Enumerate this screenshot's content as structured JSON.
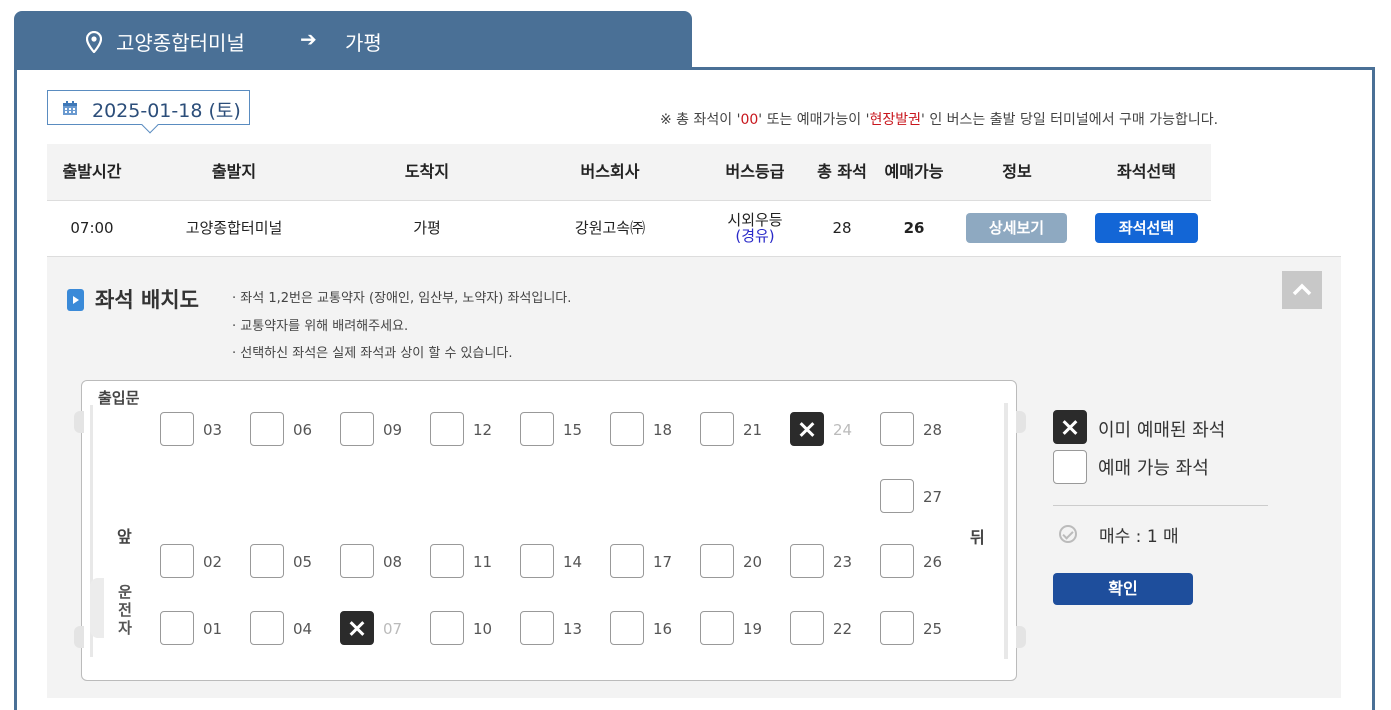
{
  "route": {
    "departure": "고양종합터미널",
    "arrow": "➔",
    "arrival": "가평"
  },
  "date": "2025-01-18 (토)",
  "notice": {
    "prefix": "※ 총 좌석이 '",
    "highlight1": "00",
    "middle": "' 또는 예매가능이 '",
    "highlight2": "현장발권",
    "suffix": "' 인 버스는 출발 당일 터미널에서 구매 가능합니다."
  },
  "table": {
    "headers": [
      "출발시간",
      "출발지",
      "도착지",
      "버스회사",
      "버스등급",
      "총 좌석",
      "예매가능",
      "정보",
      "좌석선택"
    ],
    "row": {
      "time": "07:00",
      "departure": "고양종합터미널",
      "arrival": "가평",
      "company": "강원고속㈜",
      "grade": "시외우등",
      "grade_sub": "(경유)",
      "total_seats": "28",
      "available": "26",
      "detail_button": "상세보기",
      "select_button": "좌석선택"
    }
  },
  "seat_panel": {
    "title": "좌석 배치도",
    "notes": [
      "· 좌석 1,2번은 교통약자 (장애인, 임산부, 노약자) 좌석입니다.",
      "· 교통약자를 위해 배려해주세요.",
      "· 선택하신 좌석은 실제 좌석과 상이 할 수 있습니다."
    ],
    "door_label": "출입문",
    "front_label": "앞",
    "back_label": "뒤",
    "driver_label": "운전자",
    "seat_rows": [
      [
        {
          "num": "03",
          "booked": false
        },
        {
          "num": "06",
          "booked": false
        },
        {
          "num": "09",
          "booked": false
        },
        {
          "num": "12",
          "booked": false
        },
        {
          "num": "15",
          "booked": false
        },
        {
          "num": "18",
          "booked": false
        },
        {
          "num": "21",
          "booked": false
        },
        {
          "num": "24",
          "booked": true
        },
        {
          "num": "28",
          "booked": false
        }
      ],
      [
        {
          "num": "27",
          "booked": false
        }
      ],
      [
        {
          "num": "02",
          "booked": false
        },
        {
          "num": "05",
          "booked": false
        },
        {
          "num": "08",
          "booked": false
        },
        {
          "num": "11",
          "booked": false
        },
        {
          "num": "14",
          "booked": false
        },
        {
          "num": "17",
          "booked": false
        },
        {
          "num": "20",
          "booked": false
        },
        {
          "num": "23",
          "booked": false
        },
        {
          "num": "26",
          "booked": false
        }
      ],
      [
        {
          "num": "01",
          "booked": false
        },
        {
          "num": "04",
          "booked": false
        },
        {
          "num": "07",
          "booked": true
        },
        {
          "num": "10",
          "booked": false
        },
        {
          "num": "13",
          "booked": false
        },
        {
          "num": "16",
          "booked": false
        },
        {
          "num": "19",
          "booked": false
        },
        {
          "num": "22",
          "booked": false
        },
        {
          "num": "25",
          "booked": false
        }
      ]
    ],
    "legend": {
      "booked": "이미 예매된 좌석",
      "available": "예매 가능 좌석"
    },
    "count_text": "매수 : 1 매",
    "confirm_button": "확인"
  },
  "colors": {
    "header_blue": "#4a7096",
    "select_button": "#1366d6",
    "confirm_button": "#1e4e9c",
    "notice_red": "#c8161d"
  }
}
